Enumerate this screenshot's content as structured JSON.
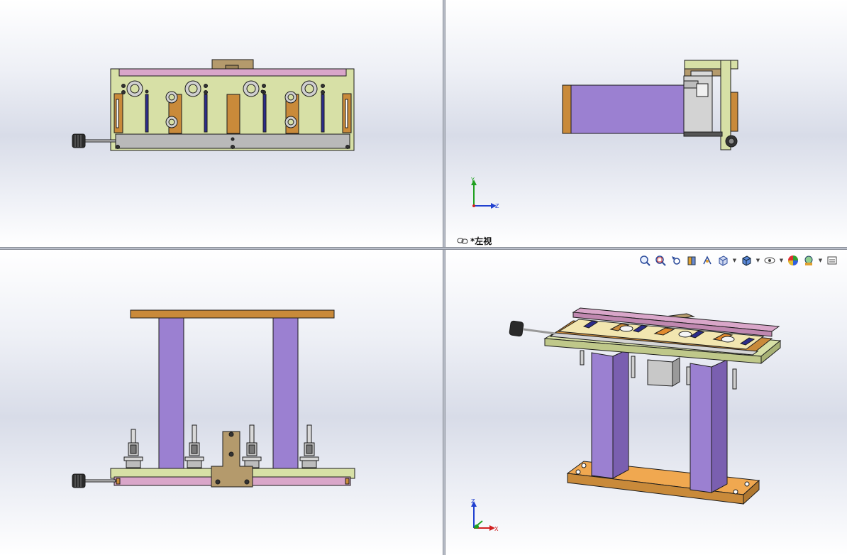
{
  "viewports": {
    "top_left": {
      "name": "front"
    },
    "top_right": {
      "name": "left",
      "label": "*左视"
    },
    "bottom_left": {
      "name": "top"
    },
    "bottom_right": {
      "name": "isometric"
    }
  },
  "triads": {
    "left_view": {
      "up": "Y",
      "right": "Z"
    },
    "iso_view": {
      "up": "Z",
      "right": "X"
    }
  },
  "toolbar": {
    "buttons": [
      {
        "icon": "zoom-to-fit-icon"
      },
      {
        "icon": "zoom-to-area-icon"
      },
      {
        "icon": "previous-view-icon"
      },
      {
        "icon": "section-view-icon"
      },
      {
        "icon": "dynamic-annotation-icon"
      },
      {
        "icon": "view-orientation-icon",
        "dropdown": true
      },
      {
        "icon": "display-style-icon",
        "dropdown": true
      },
      {
        "icon": "hide-show-items-icon",
        "dropdown": true
      },
      {
        "icon": "edit-appearance-icon"
      },
      {
        "icon": "apply-scene-icon",
        "dropdown": true
      },
      {
        "icon": "view-settings-icon"
      }
    ]
  },
  "colors": {
    "mint": "#d7e0a6",
    "pink": "#d9a6c9",
    "purple": "#9b80d1",
    "orange": "#c98a3a",
    "orange_light": "#f0a850",
    "tan": "#b49a6c",
    "grey": "#b9b9b9",
    "navy": "#2c2c8a",
    "outline": "#1c1c1c",
    "axis_x": "#d02020",
    "axis_y": "#1fa01f",
    "axis_z": "#2040d0"
  }
}
